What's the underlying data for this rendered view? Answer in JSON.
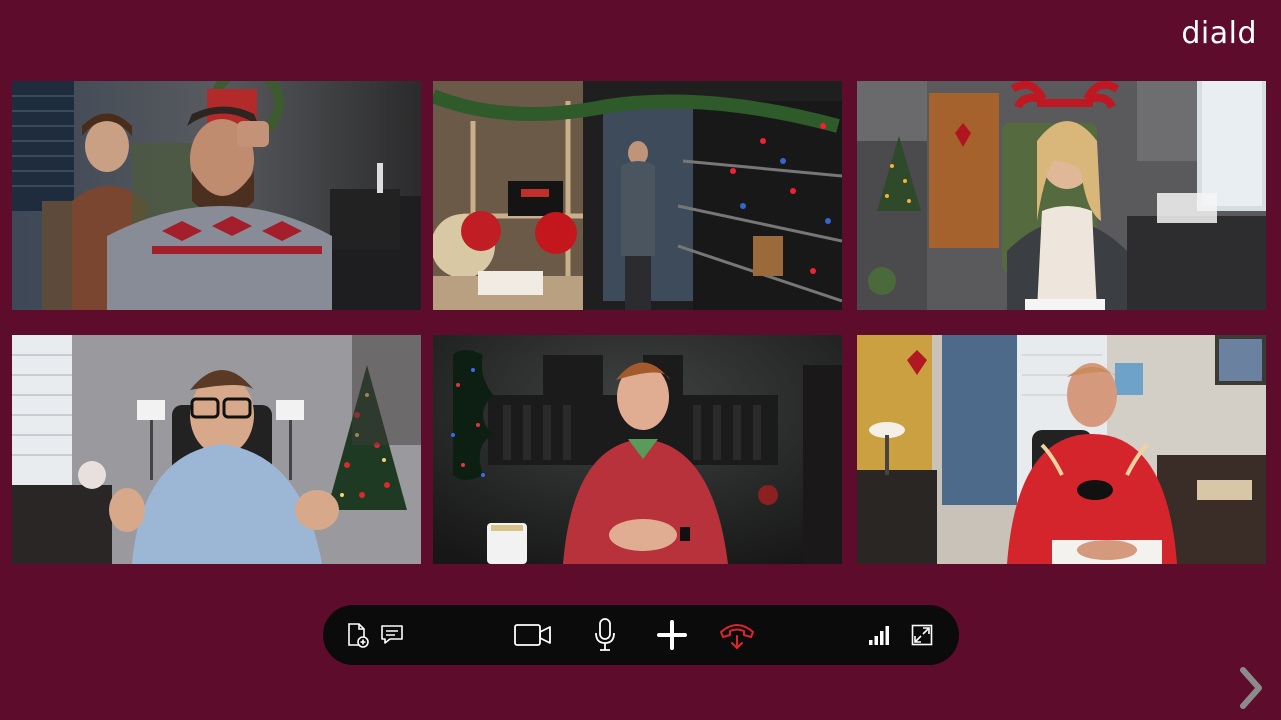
{
  "app": {
    "logo_text": "diald"
  },
  "participants": [
    {
      "id": "p1",
      "scene": "office-two-men-sweater"
    },
    {
      "id": "p2",
      "scene": "workshop-shelves-ornaments"
    },
    {
      "id": "p3",
      "scene": "woman-reindeer-antlers"
    },
    {
      "id": "p4",
      "scene": "man-glasses-blue-shirt-tree"
    },
    {
      "id": "p5",
      "scene": "man-red-henley-studio"
    },
    {
      "id": "p6",
      "scene": "man-red-reindeer-tshirt"
    }
  ],
  "controls": [
    {
      "name": "share-file",
      "icon": "file-add-icon"
    },
    {
      "name": "chat",
      "icon": "chat-icon"
    },
    {
      "name": "video",
      "icon": "video-camera-icon"
    },
    {
      "name": "microphone",
      "icon": "microphone-icon"
    },
    {
      "name": "add-participant",
      "icon": "plus-icon"
    },
    {
      "name": "end-call",
      "icon": "phone-hangup-icon"
    },
    {
      "name": "signal",
      "icon": "signal-bars-icon"
    },
    {
      "name": "fullscreen",
      "icon": "expand-icon"
    }
  ],
  "navigation": {
    "next_icon": "chevron-right-icon"
  },
  "colors": {
    "background": "#5e0c2b",
    "toolbar": "#0b0b0b",
    "icon": "#ffffff",
    "end_call": "#e0242f"
  }
}
